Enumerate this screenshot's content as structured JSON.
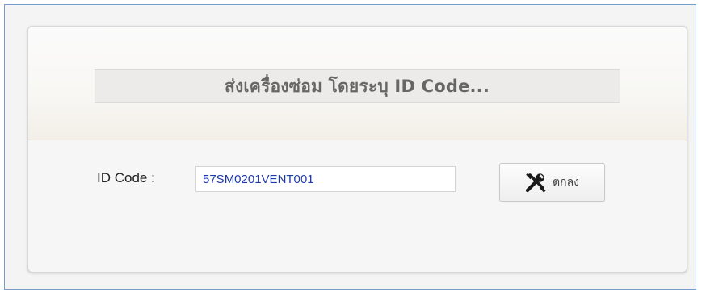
{
  "header": {
    "title": "ส่งเครื่องซ่อม โดยระบุ ID Code..."
  },
  "form": {
    "id_label": "ID Code :",
    "id_value": "57SM0201VENT001"
  },
  "actions": {
    "ok_label": "ตกลง",
    "ok_icon": "tools-icon"
  },
  "colors": {
    "frame_border": "#7a9cc8",
    "input_text": "#1f3aa8",
    "title_text": "#666666"
  }
}
